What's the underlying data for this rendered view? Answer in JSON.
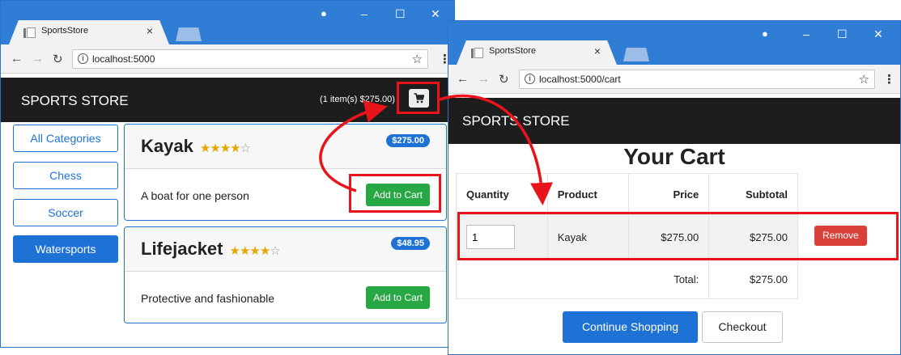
{
  "colors": {
    "titlebar": "#2f7dd4",
    "navbar": "#1d1d1d",
    "primary": "#1e72d6",
    "success": "#28a745",
    "danger": "#d9403a",
    "annotation": "#e8141a",
    "stars": "#e5a600"
  },
  "store_window": {
    "tab_title": "SportsStore",
    "url": "localhost:5000",
    "brand": "SPORTS STORE",
    "cart_summary": "(1 item(s) $275.00)",
    "cart_button_icon": "shopping-cart-icon",
    "categories": [
      {
        "label": "All Categories",
        "active": false
      },
      {
        "label": "Chess",
        "active": false
      },
      {
        "label": "Soccer",
        "active": false
      },
      {
        "label": "Watersports",
        "active": true
      }
    ],
    "products": [
      {
        "name": "Kayak",
        "price": "$275.00",
        "description": "A boat for one person",
        "add_label": "Add to Cart",
        "rating": 4
      },
      {
        "name": "Lifejacket",
        "price": "$48.95",
        "description": "Protective and fashionable",
        "add_label": "Add to Cart",
        "rating": 4
      }
    ]
  },
  "cart_window": {
    "tab_title": "SportsStore",
    "url": "localhost:5000/cart",
    "brand": "SPORTS STORE",
    "title": "Your Cart",
    "columns": [
      "Quantity",
      "Product",
      "Price",
      "Subtotal"
    ],
    "lines": [
      {
        "quantity": "1",
        "product": "Kayak",
        "price": "$275.00",
        "subtotal": "$275.00",
        "remove_label": "Remove"
      }
    ],
    "total_label": "Total:",
    "total_value": "$275.00",
    "continue_label": "Continue Shopping",
    "checkout_label": "Checkout"
  }
}
